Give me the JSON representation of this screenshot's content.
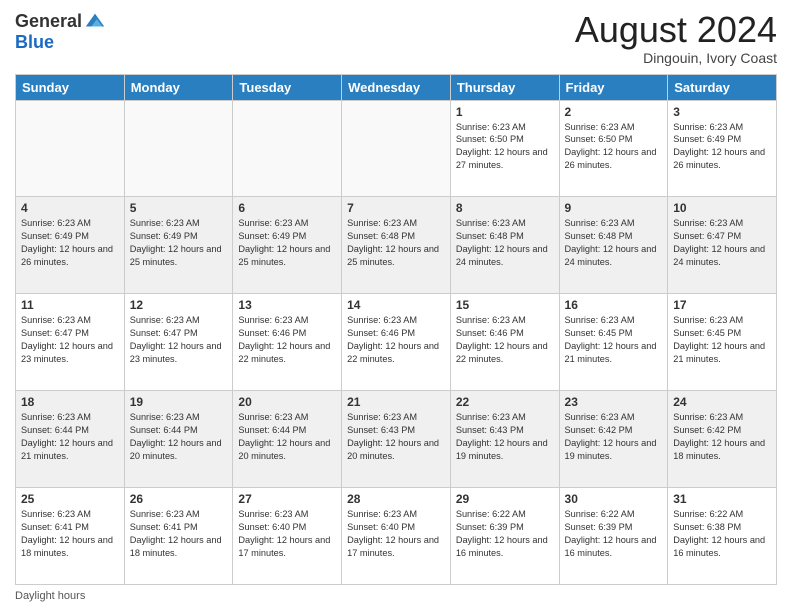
{
  "header": {
    "logo_general": "General",
    "logo_blue": "Blue",
    "month_title": "August 2024",
    "location": "Dingouin, Ivory Coast"
  },
  "footer": {
    "daylight_label": "Daylight hours"
  },
  "weekdays": [
    "Sunday",
    "Monday",
    "Tuesday",
    "Wednesday",
    "Thursday",
    "Friday",
    "Saturday"
  ],
  "weeks": [
    [
      {
        "day": "",
        "info": ""
      },
      {
        "day": "",
        "info": ""
      },
      {
        "day": "",
        "info": ""
      },
      {
        "day": "",
        "info": ""
      },
      {
        "day": "1",
        "info": "Sunrise: 6:23 AM\nSunset: 6:50 PM\nDaylight: 12 hours\nand 27 minutes."
      },
      {
        "day": "2",
        "info": "Sunrise: 6:23 AM\nSunset: 6:50 PM\nDaylight: 12 hours\nand 26 minutes."
      },
      {
        "day": "3",
        "info": "Sunrise: 6:23 AM\nSunset: 6:49 PM\nDaylight: 12 hours\nand 26 minutes."
      }
    ],
    [
      {
        "day": "4",
        "info": "Sunrise: 6:23 AM\nSunset: 6:49 PM\nDaylight: 12 hours\nand 26 minutes."
      },
      {
        "day": "5",
        "info": "Sunrise: 6:23 AM\nSunset: 6:49 PM\nDaylight: 12 hours\nand 25 minutes."
      },
      {
        "day": "6",
        "info": "Sunrise: 6:23 AM\nSunset: 6:49 PM\nDaylight: 12 hours\nand 25 minutes."
      },
      {
        "day": "7",
        "info": "Sunrise: 6:23 AM\nSunset: 6:48 PM\nDaylight: 12 hours\nand 25 minutes."
      },
      {
        "day": "8",
        "info": "Sunrise: 6:23 AM\nSunset: 6:48 PM\nDaylight: 12 hours\nand 24 minutes."
      },
      {
        "day": "9",
        "info": "Sunrise: 6:23 AM\nSunset: 6:48 PM\nDaylight: 12 hours\nand 24 minutes."
      },
      {
        "day": "10",
        "info": "Sunrise: 6:23 AM\nSunset: 6:47 PM\nDaylight: 12 hours\nand 24 minutes."
      }
    ],
    [
      {
        "day": "11",
        "info": "Sunrise: 6:23 AM\nSunset: 6:47 PM\nDaylight: 12 hours\nand 23 minutes."
      },
      {
        "day": "12",
        "info": "Sunrise: 6:23 AM\nSunset: 6:47 PM\nDaylight: 12 hours\nand 23 minutes."
      },
      {
        "day": "13",
        "info": "Sunrise: 6:23 AM\nSunset: 6:46 PM\nDaylight: 12 hours\nand 22 minutes."
      },
      {
        "day": "14",
        "info": "Sunrise: 6:23 AM\nSunset: 6:46 PM\nDaylight: 12 hours\nand 22 minutes."
      },
      {
        "day": "15",
        "info": "Sunrise: 6:23 AM\nSunset: 6:46 PM\nDaylight: 12 hours\nand 22 minutes."
      },
      {
        "day": "16",
        "info": "Sunrise: 6:23 AM\nSunset: 6:45 PM\nDaylight: 12 hours\nand 21 minutes."
      },
      {
        "day": "17",
        "info": "Sunrise: 6:23 AM\nSunset: 6:45 PM\nDaylight: 12 hours\nand 21 minutes."
      }
    ],
    [
      {
        "day": "18",
        "info": "Sunrise: 6:23 AM\nSunset: 6:44 PM\nDaylight: 12 hours\nand 21 minutes."
      },
      {
        "day": "19",
        "info": "Sunrise: 6:23 AM\nSunset: 6:44 PM\nDaylight: 12 hours\nand 20 minutes."
      },
      {
        "day": "20",
        "info": "Sunrise: 6:23 AM\nSunset: 6:44 PM\nDaylight: 12 hours\nand 20 minutes."
      },
      {
        "day": "21",
        "info": "Sunrise: 6:23 AM\nSunset: 6:43 PM\nDaylight: 12 hours\nand 20 minutes."
      },
      {
        "day": "22",
        "info": "Sunrise: 6:23 AM\nSunset: 6:43 PM\nDaylight: 12 hours\nand 19 minutes."
      },
      {
        "day": "23",
        "info": "Sunrise: 6:23 AM\nSunset: 6:42 PM\nDaylight: 12 hours\nand 19 minutes."
      },
      {
        "day": "24",
        "info": "Sunrise: 6:23 AM\nSunset: 6:42 PM\nDaylight: 12 hours\nand 18 minutes."
      }
    ],
    [
      {
        "day": "25",
        "info": "Sunrise: 6:23 AM\nSunset: 6:41 PM\nDaylight: 12 hours\nand 18 minutes."
      },
      {
        "day": "26",
        "info": "Sunrise: 6:23 AM\nSunset: 6:41 PM\nDaylight: 12 hours\nand 18 minutes."
      },
      {
        "day": "27",
        "info": "Sunrise: 6:23 AM\nSunset: 6:40 PM\nDaylight: 12 hours\nand 17 minutes."
      },
      {
        "day": "28",
        "info": "Sunrise: 6:23 AM\nSunset: 6:40 PM\nDaylight: 12 hours\nand 17 minutes."
      },
      {
        "day": "29",
        "info": "Sunrise: 6:22 AM\nSunset: 6:39 PM\nDaylight: 12 hours\nand 16 minutes."
      },
      {
        "day": "30",
        "info": "Sunrise: 6:22 AM\nSunset: 6:39 PM\nDaylight: 12 hours\nand 16 minutes."
      },
      {
        "day": "31",
        "info": "Sunrise: 6:22 AM\nSunset: 6:38 PM\nDaylight: 12 hours\nand 16 minutes."
      }
    ]
  ]
}
